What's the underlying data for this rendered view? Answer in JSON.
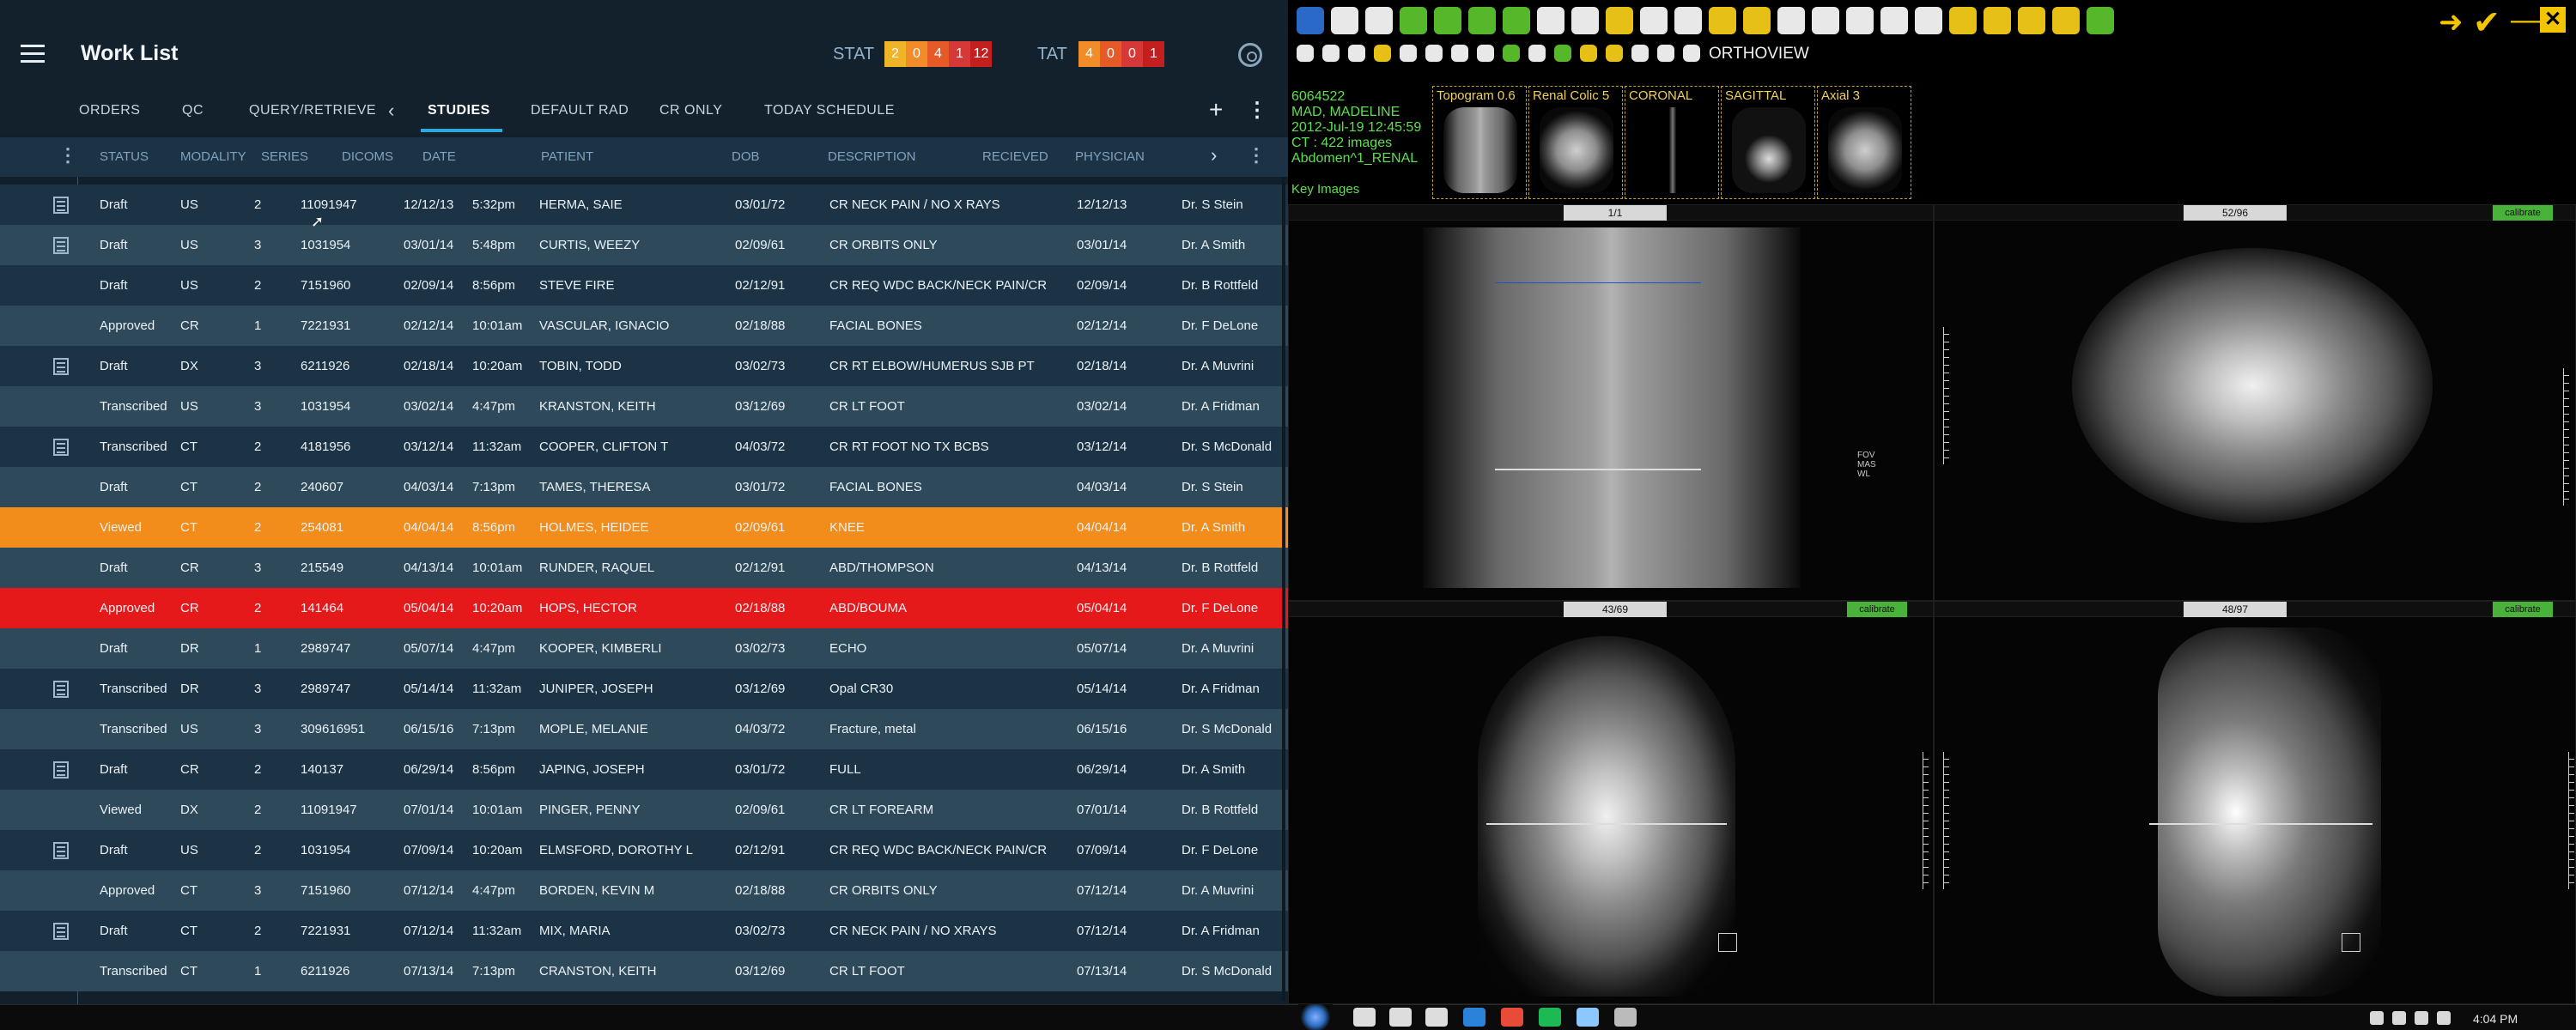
{
  "header": {
    "title": "Work List",
    "stat_label": "STAT",
    "stat_values": [
      "2",
      "0",
      "4",
      "1",
      "12"
    ],
    "tat_label": "TAT",
    "tat_values": [
      "4",
      "0",
      "0",
      "1"
    ]
  },
  "tabs": {
    "items": [
      "ORDERS",
      "QC",
      "QUERY/RETRIEVE",
      "STUDIES",
      "DEFAULT RAD",
      "CR ONLY",
      "TODAY SCHEDULE"
    ],
    "active": "STUDIES"
  },
  "columns": [
    "STATUS",
    "MODALITY",
    "SERIES",
    "DICOMS",
    "DATE",
    "PATIENT",
    "DOB",
    "DESCRIPTION",
    "RECIEVED",
    "PHYSICIAN"
  ],
  "rows": [
    {
      "status": "Draft",
      "modality": "US",
      "series": "2",
      "dicoms": "11091947",
      "date": "12/12/13",
      "time": "5:32pm",
      "patient": "HERMA, SAIE",
      "dob": "03/01/72",
      "description": "CR NECK PAIN / NO X RAYS",
      "received": "12/12/13",
      "physician": "Dr. S Stein",
      "note": true
    },
    {
      "status": "Draft",
      "modality": "US",
      "series": "3",
      "dicoms": "1031954",
      "date": "03/01/14",
      "time": "5:48pm",
      "patient": "CURTIS, WEEZY",
      "dob": "02/09/61",
      "description": "CR ORBITS ONLY",
      "received": "03/01/14",
      "physician": "Dr. A Smith",
      "note": true
    },
    {
      "status": "Draft",
      "modality": "US",
      "series": "2",
      "dicoms": "7151960",
      "date": "02/09/14",
      "time": "8:56pm",
      "patient": "STEVE FIRE",
      "dob": "02/12/91",
      "description": "CR REQ WDC BACK/NECK PAIN/CR",
      "received": "02/09/14",
      "physician": "Dr. B Rottfeld",
      "note": false
    },
    {
      "status": "Approved",
      "modality": "CR",
      "series": "1",
      "dicoms": "7221931",
      "date": "02/12/14",
      "time": "10:01am",
      "patient": "VASCULAR, IGNACIO",
      "dob": "02/18/88",
      "description": "FACIAL BONES",
      "received": "02/12/14",
      "physician": "Dr. F DeLone",
      "note": false
    },
    {
      "status": "Draft",
      "modality": "DX",
      "series": "3",
      "dicoms": "6211926",
      "date": "02/18/14",
      "time": "10:20am",
      "patient": "TOBIN, TODD",
      "dob": "03/02/73",
      "description": "CR RT ELBOW/HUMERUS SJB PT",
      "received": "02/18/14",
      "physician": "Dr. A Muvrini",
      "note": true
    },
    {
      "status": "Transcribed",
      "modality": "US",
      "series": "3",
      "dicoms": "1031954",
      "date": "03/02/14",
      "time": "4:47pm",
      "patient": "KRANSTON, KEITH",
      "dob": "03/12/69",
      "description": "CR LT FOOT",
      "received": "03/02/14",
      "physician": "Dr. A Fridman",
      "note": false
    },
    {
      "status": "Transcribed",
      "modality": "CT",
      "series": "2",
      "dicoms": "4181956",
      "date": "03/12/14",
      "time": "11:32am",
      "patient": "COOPER, CLIFTON T",
      "dob": "04/03/72",
      "description": "CR RT FOOT NO TX BCBS",
      "received": "03/12/14",
      "physician": "Dr. S McDonald",
      "note": true
    },
    {
      "status": "Draft",
      "modality": "CT",
      "series": "2",
      "dicoms": "240607",
      "date": "04/03/14",
      "time": "7:13pm",
      "patient": "TAMES, THERESA",
      "dob": "03/01/72",
      "description": "FACIAL BONES",
      "received": "04/03/14",
      "physician": "Dr. S Stein",
      "note": false
    },
    {
      "status": "Viewed",
      "modality": "CT",
      "series": "2",
      "dicoms": "254081",
      "date": "04/04/14",
      "time": "8:56pm",
      "patient": "HOLMES, HEIDEE",
      "dob": "02/09/61",
      "description": "KNEE",
      "received": "04/04/14",
      "physician": "Dr. A Smith",
      "note": false,
      "highlight": "viewed"
    },
    {
      "status": "Draft",
      "modality": "CR",
      "series": "3",
      "dicoms": "215549",
      "date": "04/13/14",
      "time": "10:01am",
      "patient": "RUNDER, RAQUEL",
      "dob": "02/12/91",
      "description": "ABD/THOMPSON",
      "received": "04/13/14",
      "physician": "Dr. B Rottfeld",
      "note": false
    },
    {
      "status": "Approved",
      "modality": "CR",
      "series": "2",
      "dicoms": "141464",
      "date": "05/04/14",
      "time": "10:20am",
      "patient": "HOPS, HECTOR",
      "dob": "02/18/88",
      "description": "ABD/BOUMA",
      "received": "05/04/14",
      "physician": "Dr. F DeLone",
      "note": false,
      "highlight": "approved"
    },
    {
      "status": "Draft",
      "modality": "DR",
      "series": "1",
      "dicoms": "2989747",
      "date": "05/07/14",
      "time": "4:47pm",
      "patient": "KOOPER, KIMBERLI",
      "dob": "03/02/73",
      "description": "ECHO",
      "received": "05/07/14",
      "physician": "Dr. A Muvrini",
      "note": false
    },
    {
      "status": "Transcribed",
      "modality": "DR",
      "series": "3",
      "dicoms": "2989747",
      "date": "05/14/14",
      "time": "11:32am",
      "patient": "JUNIPER, JOSEPH",
      "dob": "03/12/69",
      "description": "Opal CR30",
      "received": "05/14/14",
      "physician": "Dr. A Fridman",
      "note": true
    },
    {
      "status": "Transcribed",
      "modality": "US",
      "series": "3",
      "dicoms": "309616951",
      "date": "06/15/16",
      "time": "7:13pm",
      "patient": "MOPLE, MELANIE",
      "dob": "04/03/72",
      "description": "Fracture, metal",
      "received": "06/15/16",
      "physician": "Dr. S McDonald",
      "note": false
    },
    {
      "status": "Draft",
      "modality": "CR",
      "series": "2",
      "dicoms": "140137",
      "date": "06/29/14",
      "time": "8:56pm",
      "patient": "JAPING, JOSEPH",
      "dob": "03/01/72",
      "description": "FULL",
      "received": "06/29/14",
      "physician": "Dr. A Smith",
      "note": true
    },
    {
      "status": "Viewed",
      "modality": "DX",
      "series": "2",
      "dicoms": "11091947",
      "date": "07/01/14",
      "time": "10:01am",
      "patient": "PINGER, PENNY",
      "dob": "02/09/61",
      "description": "CR LT FOREARM",
      "received": "07/01/14",
      "physician": "Dr. B Rottfeld",
      "note": false
    },
    {
      "status": "Draft",
      "modality": "US",
      "series": "2",
      "dicoms": "1031954",
      "date": "07/09/14",
      "time": "10:20am",
      "patient": "ELMSFORD, DOROTHY L",
      "dob": "02/12/91",
      "description": "CR REQ WDC BACK/NECK PAIN/CR",
      "received": "07/09/14",
      "physician": "Dr. F DeLone",
      "note": true
    },
    {
      "status": "Approved",
      "modality": "CT",
      "series": "3",
      "dicoms": "7151960",
      "date": "07/12/14",
      "time": "4:47pm",
      "patient": "BORDEN, KEVIN M",
      "dob": "02/18/88",
      "description": "CR ORBITS ONLY",
      "received": "07/12/14",
      "physician": "Dr. A Muvrini",
      "note": false
    },
    {
      "status": "Draft",
      "modality": "CT",
      "series": "2",
      "dicoms": "7221931",
      "date": "07/12/14",
      "time": "11:32am",
      "patient": "MIX, MARIA",
      "dob": "03/02/73",
      "description": "CR NECK PAIN / NO XRAYS",
      "received": "07/12/14",
      "physician": "Dr. A Fridman",
      "note": true
    },
    {
      "status": "Transcribed",
      "modality": "CT",
      "series": "1",
      "dicoms": "6211926",
      "date": "07/13/14",
      "time": "7:13pm",
      "patient": "CRANSTON, KEITH",
      "dob": "03/12/69",
      "description": "CR LT FOOT",
      "received": "07/13/14",
      "physician": "Dr. S McDonald",
      "note": false
    }
  ],
  "viewer": {
    "mode": "ORTHOVIEW",
    "patient_info": [
      "6064522",
      "MAD, MADELINE",
      "2012-Jul-19 12:45:59",
      "CT : 422 images",
      "Abdomen^1_RENAL"
    ],
    "key_images": "Key Images",
    "thumbs": [
      "Topogram 0.6",
      "Renal Colic 5",
      "CORONAL",
      "SAGITTAL",
      "Axial 3"
    ],
    "viewport_counts": [
      "1/1",
      "52/96",
      "43/69",
      "48/97"
    ],
    "calibrate": "calibrate"
  },
  "taskbar": {
    "time": "4:04 PM"
  }
}
